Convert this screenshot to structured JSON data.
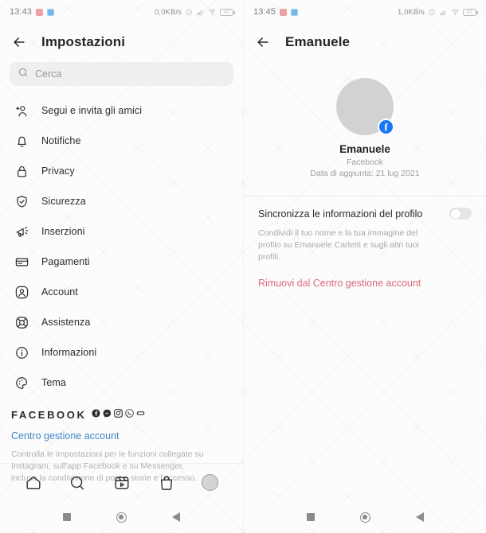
{
  "left": {
    "status": {
      "clock": "13:43",
      "network_speed": "0,0KB/s",
      "battery_level": "47",
      "app_icons": [
        "messenger-icon",
        "telegram-icon"
      ]
    },
    "appbar": {
      "title": "Impostazioni",
      "back": "back-arrow-icon"
    },
    "search": {
      "placeholder": "Cerca",
      "value": "",
      "icon": "search-icon"
    },
    "items": [
      {
        "label": "Segui e invita gli amici",
        "icon": "person-add-icon"
      },
      {
        "label": "Notifiche",
        "icon": "bell-icon"
      },
      {
        "label": "Privacy",
        "icon": "lock-icon"
      },
      {
        "label": "Sicurezza",
        "icon": "shield-check-icon"
      },
      {
        "label": "Inserzioni",
        "icon": "megaphone-icon"
      },
      {
        "label": "Pagamenti",
        "icon": "credit-card-icon"
      },
      {
        "label": "Account",
        "icon": "account-circle-icon"
      },
      {
        "label": "Assistenza",
        "icon": "lifebuoy-icon"
      },
      {
        "label": "Informazioni",
        "icon": "info-circle-icon"
      },
      {
        "label": "Tema",
        "icon": "palette-icon"
      }
    ],
    "footer": {
      "brand": "FACEBOOK",
      "brand_icons": [
        "facebook-icon",
        "messenger-icon",
        "instagram-icon",
        "whatsapp-icon",
        "portal-icon"
      ],
      "link": "Centro gestione account",
      "link_color": "#3f86c4",
      "description": "Controlla le impostazioni per le funzioni collegate su Instagram, sull'app Facebook e su Messenger, inclusa la condivisione di post e storie e l'accesso."
    },
    "tabs": [
      {
        "name": "home",
        "icon": "home-icon"
      },
      {
        "name": "search",
        "icon": "search-icon"
      },
      {
        "name": "reels",
        "icon": "reels-icon"
      },
      {
        "name": "shop",
        "icon": "shop-bag-icon"
      },
      {
        "name": "profile",
        "icon": "avatar-icon"
      }
    ],
    "navbar": [
      "recents-square-icon",
      "home-circle-icon",
      "back-triangle-icon"
    ]
  },
  "right": {
    "status": {
      "clock": "13:45",
      "network_speed": "1,0KB/s",
      "battery_level": "47",
      "app_icons": [
        "messenger-icon",
        "telegram-icon"
      ]
    },
    "appbar": {
      "title": "Emanuele",
      "back": "back-arrow-icon"
    },
    "profile": {
      "name": "Emanuele",
      "platform": "Facebook",
      "added_date": "Data di aggiunta: 21 lug 2021",
      "badge": "facebook-badge-icon"
    },
    "sync": {
      "label": "Sincronizza le informazioni del profilo",
      "toggle_state": "off",
      "description": "Condividi il tuo nome e la tua immagine del profilo su Emanuele Carletti e sugli altri tuoi profili."
    },
    "remove": {
      "label": "Rimuovi dal Centro gestione account",
      "color": "#db6a7a"
    },
    "navbar": [
      "recents-square-icon",
      "home-circle-icon",
      "back-triangle-icon"
    ]
  }
}
